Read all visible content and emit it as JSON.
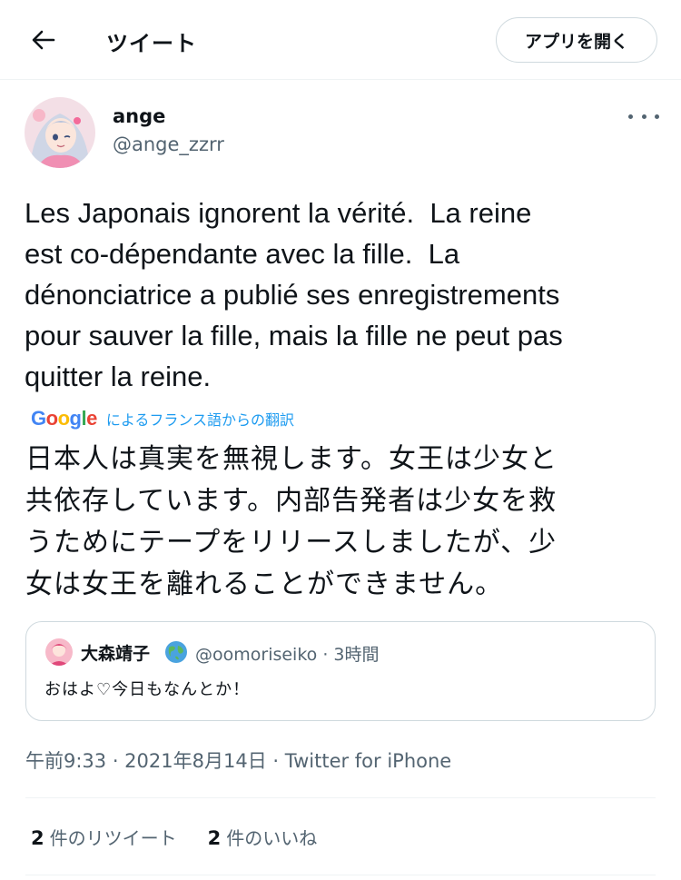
{
  "header": {
    "title": "ツイート",
    "open_app_label": "アプリを開く"
  },
  "tweet": {
    "display_name": "ange",
    "handle": "@ange_zzrr",
    "text": "Les Japonais ignorent la vérité.  La reine\nest co-dépendante avec la fille.  La\ndénonciatrice a publié ses enregistrements\npour sauver la fille, mais la fille ne peut pas\nquitter la reine.",
    "translation_provider": "Google",
    "translation_label": "によるフランス語からの翻訳",
    "translated_text_lines": [
      "日本人は真実を無視します。女王は少女と",
      "共依存しています。内部告発者は少女を救",
      "うためにテープをリリースしましたが、少",
      "女は女王を離れることができません。"
    ],
    "timestamp": "午前9:33 · 2021年8月14日 · Twitter for iPhone"
  },
  "quote": {
    "display_name": "大森靖子",
    "handle_time": "@oomoriseiko · 3時間",
    "text": "おはよ♡今日もなんとか！"
  },
  "stats": {
    "retweets_count": "2",
    "retweets_label": "件のリツイート",
    "likes_count": "2",
    "likes_label": "件のいいね"
  },
  "colors": {
    "accent": "#1d9bf0",
    "secondary_text": "#536471",
    "border": "#cfd9de"
  }
}
